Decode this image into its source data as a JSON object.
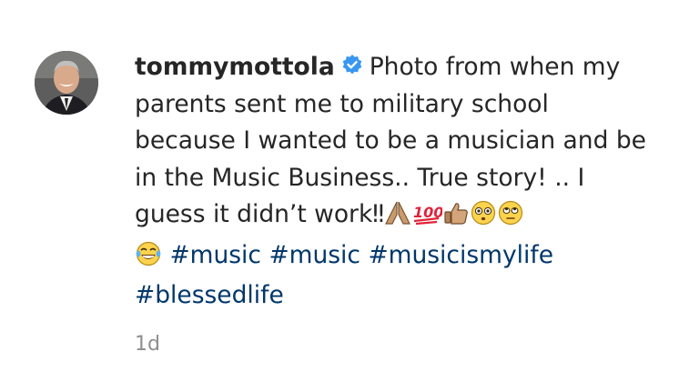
{
  "post": {
    "username": "tommymottola",
    "caption_text": "Photo from when my parents sent me to military school because I wanted to be a musician and be in the Music Business.. True story! .. I guess it didn’t work‼",
    "hashtags": [
      "#music",
      "#music",
      "#musicismylife",
      "#blessedlife"
    ],
    "timestamp": "1d",
    "verified_icon": "verified-badge-icon",
    "emojis": [
      "folded-hands-emoji",
      "hundred-points-emoji",
      "thumbs-up-emoji",
      "flushed-face-emoji",
      "eye-roll-emoji",
      "tears-of-joy-emoji"
    ],
    "colors": {
      "text": "#262626",
      "hashtag": "#00376b",
      "timestamp": "#8e8e8e",
      "verified": "#3897f0"
    }
  }
}
